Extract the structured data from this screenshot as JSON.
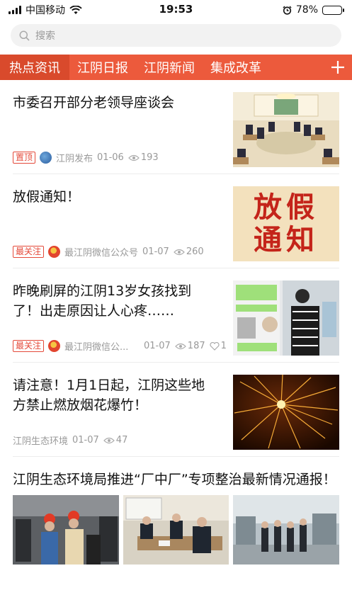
{
  "status": {
    "carrier": "中国移动",
    "time": "19:53",
    "battery": "78%",
    "battery_level": 0.78
  },
  "search": {
    "placeholder": "搜索"
  },
  "tabs": [
    {
      "label": "热点资讯",
      "active": true
    },
    {
      "label": "江阴日报"
    },
    {
      "label": "江阴新闻"
    },
    {
      "label": "集成改革"
    }
  ],
  "articles": [
    {
      "title": "市委召开部分老领导座谈会",
      "badge": "置顶",
      "source": "江阴发布",
      "date": "01-06",
      "views": "193"
    },
    {
      "title": "放假通知！",
      "badge": "最关注",
      "source": "最江阴微信公众号",
      "date": "01-07",
      "views": "260",
      "image_text": "放假\n通知"
    },
    {
      "title": "昨晚刷屏的江阴13岁女孩找到了！出走原因让人心疼……",
      "badge": "最关注",
      "source": "最江阴微信公...",
      "date": "01-07",
      "views": "187",
      "likes": "1"
    },
    {
      "title": "请注意！1月1日起，江阴这些地方禁止燃放烟花爆竹！",
      "source": "江阴生态环境",
      "date": "01-07",
      "views": "47"
    },
    {
      "title": "江阴生态环境局推进“厂中厂”专项整治最新情况通报！"
    }
  ],
  "colors": {
    "accent": "#ec5a3c",
    "badge": "#e44a3a"
  }
}
